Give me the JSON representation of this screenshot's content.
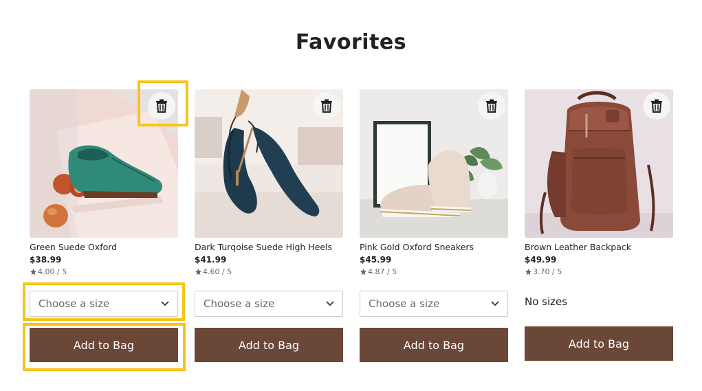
{
  "page": {
    "title": "Favorites"
  },
  "products": [
    {
      "name": "Green Suede Oxford",
      "price": "$38.99",
      "rating": "4.00 / 5",
      "size_placeholder": "Choose a size",
      "add_label": "Add to Bag",
      "image": "green-suede-oxford-shoe"
    },
    {
      "name": "Dark Turqoise Suede High Heels",
      "price": "$41.99",
      "rating": "4.60 / 5",
      "size_placeholder": "Choose a size",
      "add_label": "Add to Bag",
      "image": "dark-turquoise-high-heels"
    },
    {
      "name": "Pink Gold Oxford Sneakers",
      "price": "$45.99",
      "rating": "4.87 / 5",
      "size_placeholder": "Choose a size",
      "add_label": "Add to Bag",
      "image": "pink-gold-oxford-sneakers"
    },
    {
      "name": "Brown Leather Backpack",
      "price": "$49.99",
      "rating": "3.70 / 5",
      "no_sizes": "No sizes",
      "add_label": "Add to Bag",
      "image": "brown-leather-backpack"
    }
  ],
  "icons": {
    "remove": "trash-icon",
    "rating": "star-icon",
    "dropdown": "chevron-down-icon"
  },
  "colors": {
    "button": "#6b4737",
    "highlight": "#f5c518"
  }
}
